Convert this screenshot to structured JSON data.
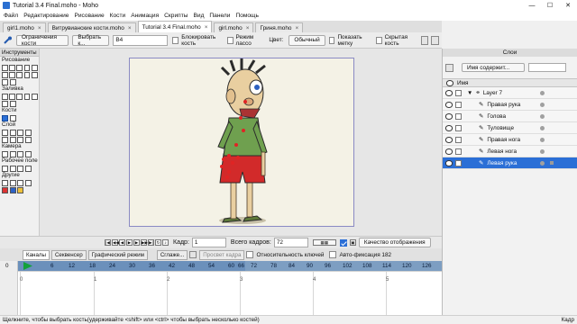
{
  "window": {
    "title": "Tutorial 3.4 Final.moho - Moho",
    "controls": [
      "—",
      "☐",
      "✕"
    ]
  },
  "menu": [
    "Файл",
    "Редактирование",
    "Рисование",
    "Кости",
    "Анимация",
    "Скрипты",
    "Вид",
    "Панели",
    "Помощь"
  ],
  "doc_tabs": [
    {
      "label": "girl1.moho",
      "close": "×"
    },
    {
      "label": "Витрувианские кости.moho",
      "close": "×"
    },
    {
      "label": "Tutorial 3.4 Final.moho",
      "close": "×"
    },
    {
      "label": "girl.moho",
      "close": "×"
    },
    {
      "label": "Гриня.moho",
      "close": "×"
    }
  ],
  "tool_options": {
    "constrain_bones": "Ограничения кости",
    "select_bone": "Выбрать к...",
    "bone_name": "B4",
    "lock_bone": "Блокировать кость",
    "lasso_mode": "Режим лассо",
    "color_label": "Цвет:",
    "color_value": "Обычный",
    "show_label": "Показать метку",
    "hidden_bone": "Скрытая кость"
  },
  "tools": {
    "header": "Инструменты",
    "sections": [
      "Рисование",
      "Заливка",
      "Кости",
      "Слой",
      "Камера",
      "Рабочее поле",
      "Другие"
    ]
  },
  "timeline_controls": {
    "frame_label": "Кадр:",
    "frame_value": "1",
    "total_label": "Всего кадров:",
    "total_value": "72",
    "quality": "Качество отображения"
  },
  "timeline_tabs": {
    "channels": "Каналы",
    "sequencer": "Секвенсер",
    "graph": "Графический режим",
    "smooth": "Сглаже...",
    "onion": "Просвет кадра",
    "relative_keys": "Относительность ключей",
    "auto_freeze": "Авто-фиксация 182"
  },
  "ruler_left": "0",
  "ruler": [
    "0",
    "6",
    "12",
    "18",
    "24",
    "30",
    "36",
    "42",
    "48",
    "54",
    "60",
    "66",
    "72",
    "78",
    "84",
    "90",
    "96",
    "102",
    "108",
    "114",
    "120",
    "126",
    "132"
  ],
  "track_ticks": [
    "0",
    "1",
    "2",
    "3",
    "4",
    "5"
  ],
  "layers": {
    "title": "Слои",
    "name_search": "Имя содержит...",
    "column": "Имя",
    "rows": [
      {
        "name": "Layer 7",
        "group": true,
        "selected": false
      },
      {
        "name": "Правая рука",
        "group": false,
        "selected": false
      },
      {
        "name": "Голова",
        "group": false,
        "selected": false
      },
      {
        "name": "Туловище",
        "group": false,
        "selected": false
      },
      {
        "name": "Правая нога",
        "group": false,
        "selected": false
      },
      {
        "name": "Левая нога",
        "group": false,
        "selected": false
      },
      {
        "name": "Левая рука",
        "group": false,
        "selected": true
      }
    ]
  },
  "status": {
    "left": "Щелкните, чтобы выбрать кость(удерживайте <shift> или <ctrl> чтобы выбрать несколько костей)",
    "right": "Кадр"
  }
}
